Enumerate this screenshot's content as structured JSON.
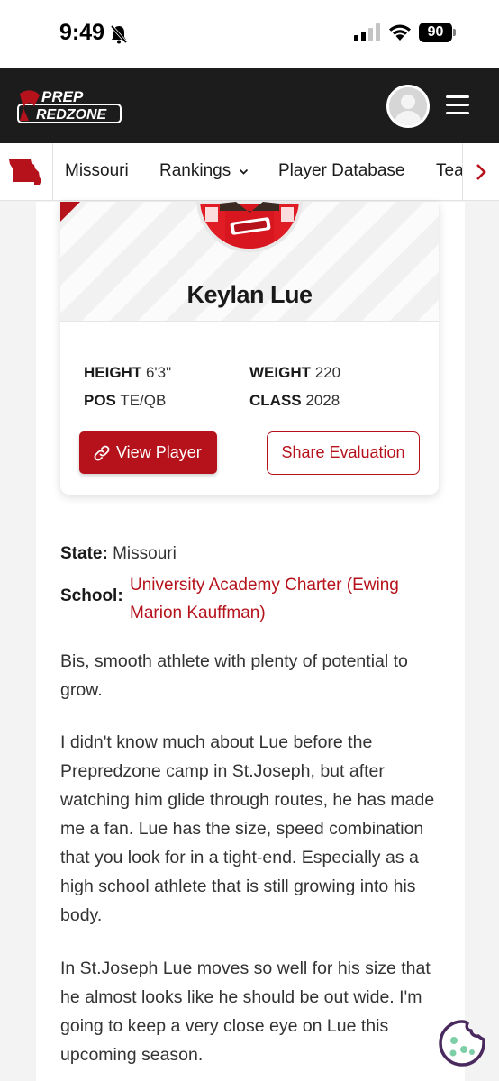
{
  "status_bar": {
    "time": "9:49",
    "battery": "90"
  },
  "header": {
    "logo_top": "PREP",
    "logo_bottom": "REDZONE"
  },
  "subnav": {
    "items": [
      "Missouri",
      "Rankings",
      "Player Database",
      "Teams"
    ]
  },
  "player": {
    "name": "Keylan Lue",
    "height_label": "HEIGHT",
    "height": "6'3\"",
    "weight_label": "WEIGHT",
    "weight": "220",
    "pos_label": "POS",
    "pos": "TE/QB",
    "class_label": "CLASS",
    "class": "2028",
    "view_button": "View Player",
    "share_button": "Share Evaluation"
  },
  "info": {
    "state_label": "State:",
    "state": "Missouri",
    "school_label": "School:",
    "school": "University Academy Charter (Ewing Marion Kauffman)"
  },
  "paragraphs": [
    "Bis, smooth athlete with plenty of potential to grow.",
    "I didn't know much about Lue before the Prepredzone camp in St.Joseph, but after watching him glide through routes, he has made me a fan. Lue has the size, speed combination that you look for in a tight-end. Especially as a high school athlete that is still growing into his body.",
    "In St.Joseph Lue moves so well for his size that he almost looks like he should be out wide. I'm going to keep a very close eye on Lue this upcoming season."
  ],
  "colors": {
    "brand_red": "#b5121b",
    "header_bg": "#1c1c1c",
    "cookie": "#4a2a5e"
  },
  "icons": [
    "bell-slash-icon",
    "signal-icon",
    "wifi-icon",
    "battery-icon",
    "profile-avatar-icon",
    "hamburger-menu-icon",
    "missouri-map-icon",
    "chevron-down-icon",
    "chevron-right-icon",
    "link-icon",
    "cookie-icon"
  ]
}
